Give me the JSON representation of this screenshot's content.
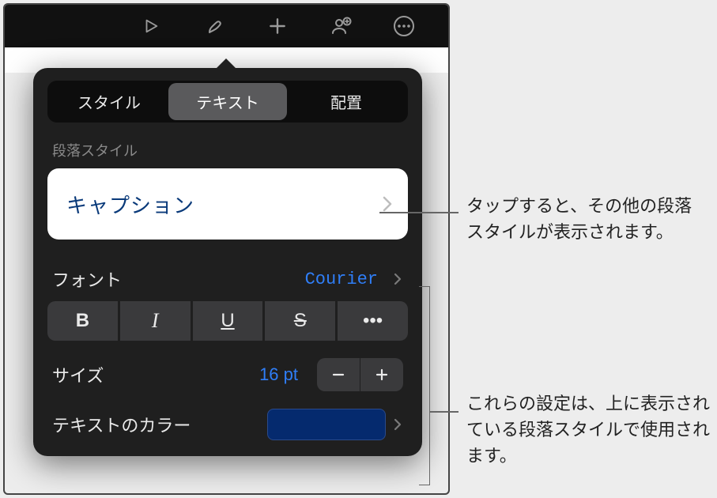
{
  "toolbar": {
    "icons": [
      "play-icon",
      "format-brush-icon",
      "add-icon",
      "collaborate-icon",
      "more-icon"
    ]
  },
  "tabs": {
    "style": "スタイル",
    "text": "テキスト",
    "arrange": "配置"
  },
  "sections": {
    "paragraphStyleLabel": "段落スタイル",
    "paragraphStyleValue": "キャプション",
    "fontLabel": "フォント",
    "fontValue": "Courier",
    "sizeLabel": "サイズ",
    "sizeValue": "16 pt",
    "textColorLabel": "テキストのカラー",
    "textColorValue": "#052a6e"
  },
  "styleButtons": {
    "bold": "B",
    "italic": "I",
    "underline": "U",
    "strike": "S",
    "more": "•••"
  },
  "callouts": {
    "c1": "タップすると、その他の段落スタイルが表示されます。",
    "c2": "これらの設定は、上に表示されている段落スタイルで使用されます。"
  }
}
